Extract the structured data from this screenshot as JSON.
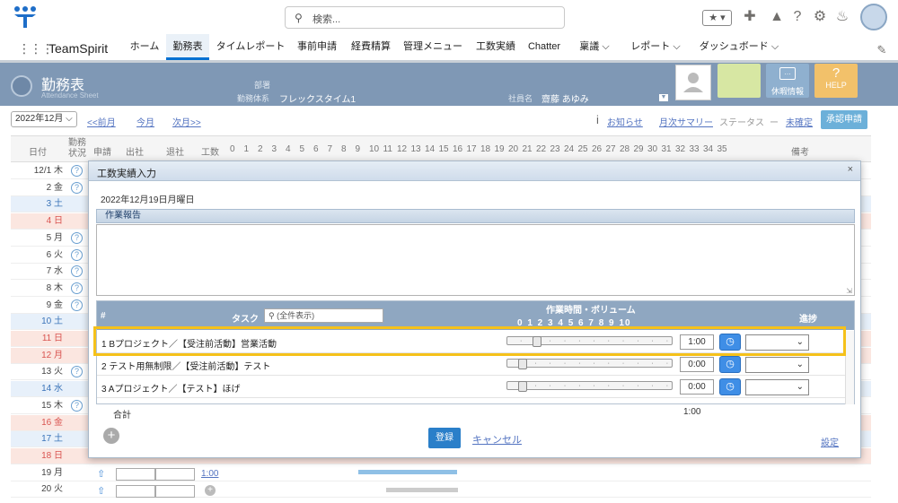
{
  "header": {
    "search_placeholder": "検索...",
    "fav_label": "★ ▾"
  },
  "nav": {
    "app_name": "TeamSpirit",
    "tabs": [
      "ホーム",
      "勤務表",
      "タイムレポート",
      "事前申請",
      "経費精算",
      "管理メニュー",
      "工数実績",
      "Chatter",
      "稟議 ⌵",
      "レポート ⌵",
      "ダッシュボード ⌵"
    ]
  },
  "attendance": {
    "title": "勤務表",
    "subtitle": "Attendance Sheet",
    "dept_label": "部署",
    "system_label": "勤務体系",
    "system_value": "フレックスタイム1",
    "employee_label": "社員名",
    "employee_value": "齋藤 あゆみ",
    "rest_label": "休暇情報",
    "help_label": "HELP"
  },
  "toolbar": {
    "month": "2022年12月",
    "prev": "<<前月",
    "current": "今月",
    "next": "次月>>",
    "notice": "お知らせ",
    "summary": "月次サマリー",
    "status_label": "ステータス",
    "status_dash": "ー",
    "status_value": "未確定",
    "approve": "承認申請"
  },
  "table": {
    "headers": {
      "date": "日付",
      "status": "勤務\n状況",
      "apply": "申請",
      "in": "出社",
      "out": "退社",
      "hours": "工数",
      "remarks": "備考"
    },
    "hour_ticks": [
      "0",
      "1",
      "2",
      "3",
      "4",
      "5",
      "6",
      "7",
      "8",
      "9",
      "10",
      "11",
      "12",
      "13",
      "14",
      "15",
      "16",
      "17",
      "18",
      "19",
      "20",
      "21",
      "22",
      "23",
      "24",
      "25",
      "26",
      "27",
      "28",
      "29",
      "30",
      "31",
      "32",
      "33",
      "34",
      "35"
    ],
    "rows": [
      {
        "date": "12/1 木",
        "type": "wd"
      },
      {
        "date": "2 金",
        "type": "wd"
      },
      {
        "date": "3 土",
        "type": "sat"
      },
      {
        "date": "4 日",
        "type": "sun"
      },
      {
        "date": "5 月",
        "type": "wd"
      },
      {
        "date": "6 火",
        "type": "wd"
      },
      {
        "date": "7 水",
        "type": "wd"
      },
      {
        "date": "8 木",
        "type": "wd"
      },
      {
        "date": "9 金",
        "type": "wd"
      },
      {
        "date": "10 土",
        "type": "sat"
      },
      {
        "date": "11 日",
        "type": "sun"
      },
      {
        "date": "12 月",
        "type": "sun"
      },
      {
        "date": "13 火",
        "type": "wd"
      },
      {
        "date": "14 水",
        "type": "sat"
      },
      {
        "date": "15 木",
        "type": "wd"
      },
      {
        "date": "16 金",
        "type": "sun"
      },
      {
        "date": "17 土",
        "type": "sat"
      },
      {
        "date": "18 日",
        "type": "sun"
      },
      {
        "date": "19 月",
        "type": "wd"
      },
      {
        "date": "20 火",
        "type": "wd"
      }
    ],
    "row19_hours": "1:00"
  },
  "modal": {
    "title": "工数実績入力",
    "close": "×",
    "date": "2022年12月19日月曜日",
    "report_header": "作業報告",
    "grid": {
      "col_num": "#",
      "col_task": "タスク",
      "search_placeholder": "(全件表示)",
      "col_volume": "作業時間・ボリューム",
      "volume_ticks": "0 1 2 3 4 5 6 7 8 9 10",
      "col_progress": "進捗",
      "tasks": [
        {
          "num": "1",
          "name": "Bプロジェクト／【受注前活動】営業活動",
          "time": "1:00",
          "level": 0.1
        },
        {
          "num": "2",
          "name": "テスト用無制限／【受注前活動】テスト",
          "time": "0:00",
          "level": 0
        },
        {
          "num": "3",
          "name": "Aプロジェクト／【テスト】ほげ",
          "time": "0:00",
          "level": 0
        }
      ],
      "total_label": "合計",
      "total_value": "1:00"
    },
    "register": "登録",
    "cancel": "キャンセル",
    "settings": "設定"
  }
}
